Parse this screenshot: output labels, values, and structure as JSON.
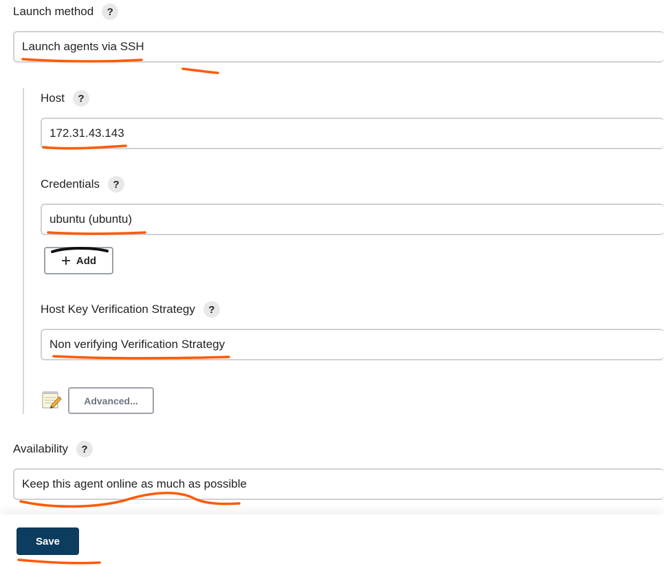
{
  "launch_method": {
    "label": "Launch method",
    "help": "?",
    "value": "Launch agents via SSH"
  },
  "host": {
    "label": "Host",
    "help": "?",
    "value": "172.31.43.143"
  },
  "credentials": {
    "label": "Credentials",
    "help": "?",
    "value": "ubuntu (ubuntu)",
    "add_label": "Add",
    "add_icon": "plus-icon"
  },
  "host_key": {
    "label": "Host Key Verification Strategy",
    "help": "?",
    "value": "Non verifying Verification Strategy"
  },
  "advanced": {
    "label": "Advanced...",
    "icon": "notepad-icon"
  },
  "availability": {
    "label": "Availability",
    "help": "?",
    "value": "Keep this agent online as much as possible"
  },
  "footer": {
    "save_label": "Save"
  },
  "colors": {
    "annotation": "#ff5a00",
    "save_button": "#0c3c5e"
  }
}
